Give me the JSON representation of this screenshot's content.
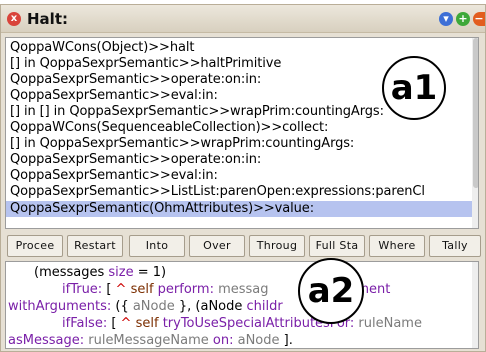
{
  "window": {
    "title": "Halt:",
    "close_glyph": "x",
    "menu_glyph": "▾",
    "expand_glyph": "+",
    "collapse_glyph": "−"
  },
  "stack": {
    "items": [
      "QoppaWCons(Object)>>halt",
      "[] in QoppaSexprSemantic>>haltPrimitive",
      "QoppaSexprSemantic>>operate:on:in:",
      "QoppaSexprSemantic>>eval:in:",
      "[] in [] in QoppaSexprSemantic>>wrapPrim:countingArgs:",
      "QoppaWCons(SequenceableCollection)>>collect:",
      "[] in QoppaSexprSemantic>>wrapPrim:countingArgs:",
      "QoppaSexprSemantic>>operate:on:in:",
      "QoppaSexprSemantic>>eval:in:",
      "QoppaSexprSemantic>>ListList:parenOpen:expressions:parenCl",
      "QoppaSexprSemantic(OhmAttributes)>>value:"
    ],
    "selected_index": 10
  },
  "annotations": {
    "a1": "a1",
    "a2": "a2"
  },
  "toolbar": {
    "buttons": [
      "Procee",
      "Restart",
      "Into",
      "Over",
      "Throug",
      "Full Sta",
      "Where",
      "Tally"
    ]
  },
  "code": {
    "line1": {
      "open": "(messages ",
      "kw": "size",
      "rest": " = 1)"
    },
    "line2": {
      "kw": "ifTrue:",
      "open": " [ ",
      "caret": "^",
      "self": " self ",
      "sel": "perform:",
      "arg": " messag",
      "tail": "eElement"
    },
    "line3": {
      "kw": "withArguments:",
      "open": " ({ ",
      "arg": "aNode",
      "close": " }, (aNode ",
      "child": "childr"
    },
    "line4": {
      "kw": "ifFalse:",
      "open": " [ ",
      "caret": "^",
      "self": " self ",
      "sel": "tryToUseSpecialAttributesFor:",
      "arg": " ruleName"
    },
    "line5": {
      "kw": "asMessage:",
      "arg1": " ruleMessageName ",
      "kw2": "on:",
      "arg2": " aNode ",
      "close": "]."
    }
  },
  "colors": {
    "selection": "#b6c3ef",
    "keyword": "#7a1fa8",
    "close_button": "#d9443b",
    "menu_button": "#3d6fd6",
    "expand_button": "#3ea83a",
    "collapse_button": "#e25d1f"
  }
}
